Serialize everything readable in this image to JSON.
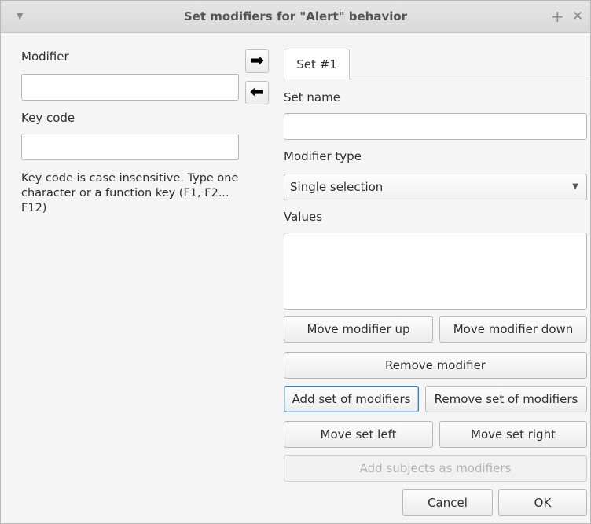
{
  "window": {
    "title": "Set modifiers for \"Alert\" behavior",
    "menu_icon": "chevron-down-icon",
    "maximize_glyph": "+",
    "close_glyph": "✕"
  },
  "left": {
    "modifier_label": "Modifier",
    "modifier_value": "",
    "keycode_label": "Key code",
    "keycode_value": "",
    "help_text": "Key code is case insensitive. Type one character or a function key (F1, F2... F12)"
  },
  "arrows": {
    "add_glyph": "➡",
    "remove_glyph": "⬅"
  },
  "tabs": [
    {
      "label": "Set #1",
      "selected": true
    }
  ],
  "set": {
    "name_label": "Set name",
    "name_value": "",
    "type_label": "Modifier type",
    "type_value": "Single selection",
    "values_label": "Values"
  },
  "buttons": {
    "move_up": "Move modifier up",
    "move_down": "Move modifier down",
    "remove_modifier": "Remove modifier",
    "add_set": "Add set of modifiers",
    "remove_set": "Remove set of modifiers",
    "move_left": "Move set left",
    "move_right": "Move set right",
    "add_subjects": "Add subjects as modifiers",
    "cancel": "Cancel",
    "ok": "OK"
  },
  "colors": {
    "focus_border": "#3d7fc1",
    "window_bg": "#f5f5f5"
  }
}
